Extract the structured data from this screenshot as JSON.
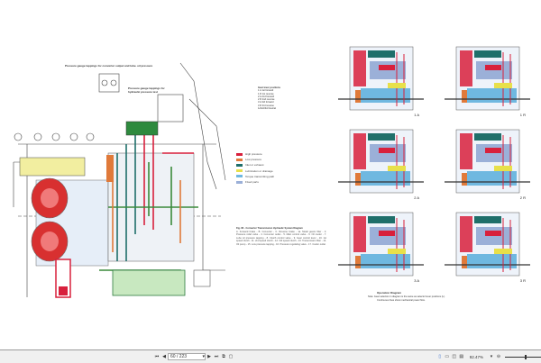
{
  "document": {
    "gauge_note_1": "Pressure gauge tappings for converter output and lube. oil pressure",
    "gauge_note_2": "Pressure gauge tappings for hydraulic pressure test",
    "gear_positions": {
      "title": "Gear lever positions",
      "items": [
        "1 A  1st forward",
        "1 R  1st reverse",
        "2 A  2nd forward",
        "2 R  2nd reverse",
        "3 A  3rd forward",
        "3 R  3rd reverse",
        "1A/2A/3A  Neutral"
      ]
    },
    "legend": [
      {
        "label": "High pressure",
        "color": "#d8203c"
      },
      {
        "label": "Low pressure",
        "color": "#e07a3a"
      },
      {
        "label": "Inlet or exhaust",
        "color": "#1f6f6a"
      },
      {
        "label": "Lubrication or drainage",
        "color": "#e8e04a"
      },
      {
        "label": "Torque transmitting path",
        "color": "#6fb8e0"
      },
      {
        "label": "Fixed parts",
        "color": "#9bb0d8"
      }
    ],
    "caption_title": "Fig. 82 - Converter Transmission Hydraulic System Diagram",
    "caption_body": "A. Forward brake - B. Converter - C. Reverse brake - 1a. Metal gauze filter - 3. Pressure relief valve - 4. Converter outlet - 5. Main control valve - 6. Oil cooler - 7. Lube oil pressure tapping - 8. Clutch control valve - 9. Gear control lever - 10. 1st speed clutch - 11. 2nd speed clutch - 12. 3rd speed clutch - 13. Transmission filter - 14. Oil pump - 15. Low pressure tapping - 16. Pressure regulating valve - 17. Cooler outlet",
    "panel_labels": [
      "1 A",
      "1 R",
      "2 A",
      "2 R",
      "3 A",
      "3 R"
    ],
    "op_title": "Operation Diagram",
    "op_note": "Note: Gear selection in diagram is the same as selector lever positions (L).",
    "op_note_2": "Continuous lines show mechanical power flow."
  },
  "toolbar": {
    "page_current": "60",
    "page_total": "223",
    "page_display": "60 / 223",
    "zoom": "92.47%"
  }
}
